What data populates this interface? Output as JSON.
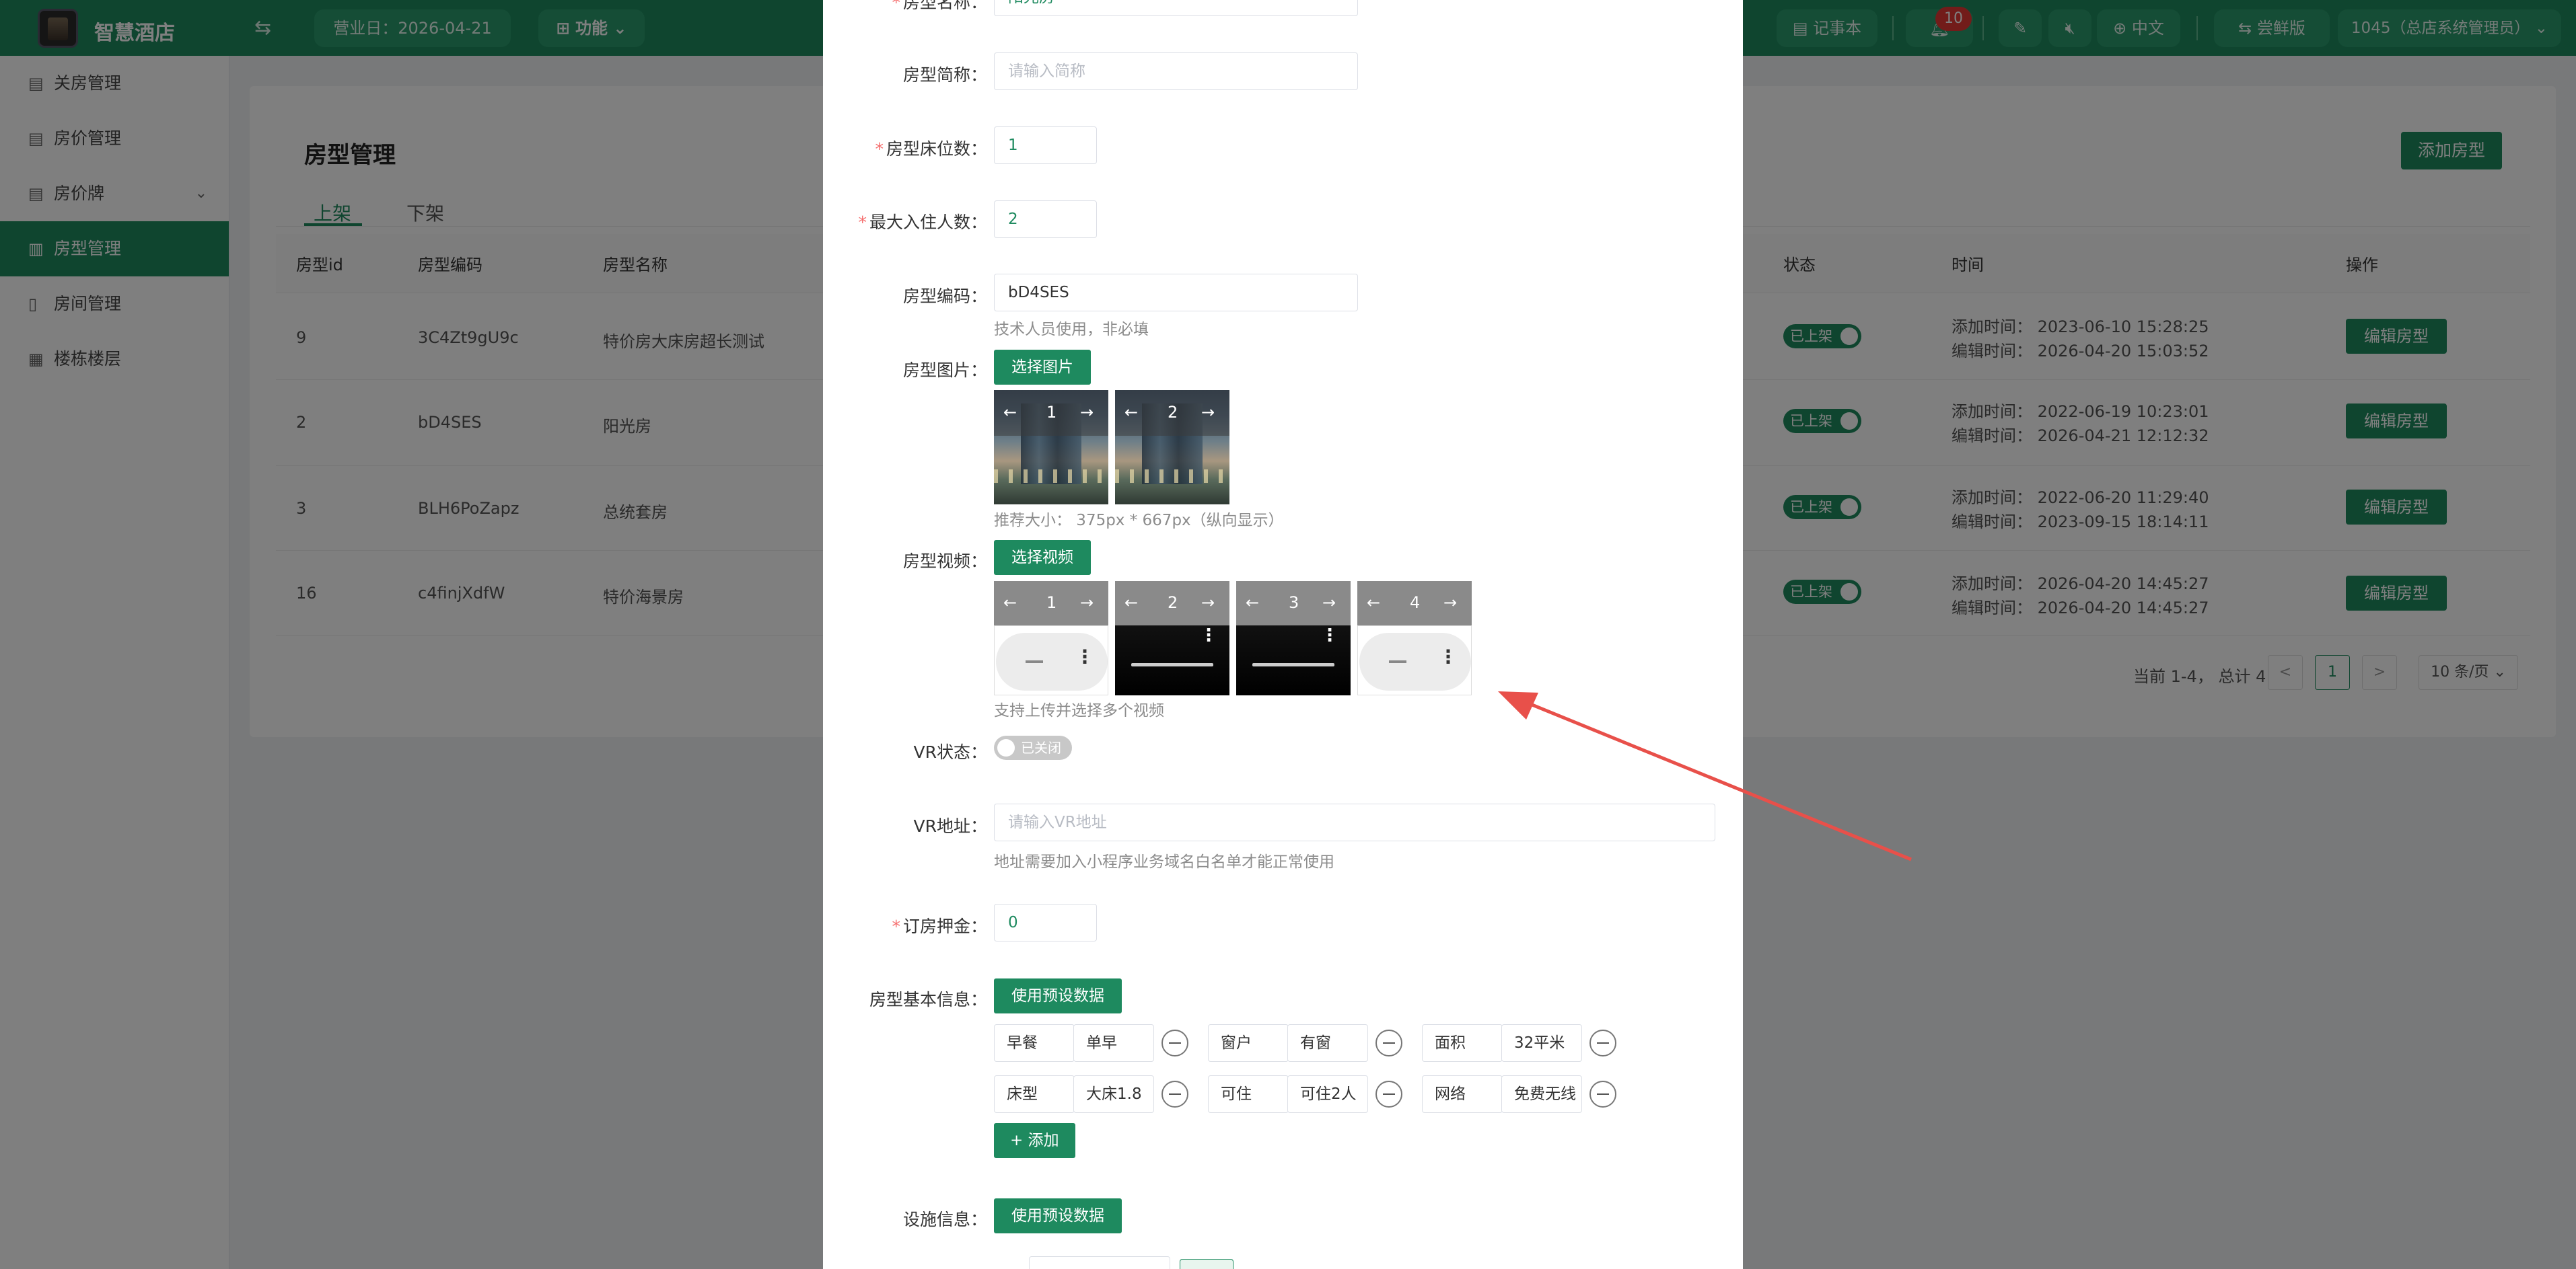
{
  "header": {
    "app_name": "智慧酒店",
    "business_date": "营业日：2026-04-21",
    "func_label": "功能",
    "notebook_label": "记事本",
    "notif_count": "10",
    "lang_label": "中文",
    "trial_label": "尝鲜版",
    "user_label": "1045（总店系统管理员）"
  },
  "sidebar": {
    "items": [
      {
        "label": "关房管理"
      },
      {
        "label": "房价管理"
      },
      {
        "label": "房价牌"
      },
      {
        "label": "房型管理"
      },
      {
        "label": "房间管理"
      },
      {
        "label": "楼栋楼层"
      }
    ]
  },
  "page": {
    "title": "房型管理",
    "add_button": "添加房型",
    "tabs": [
      "上架",
      "下架"
    ],
    "columns": {
      "id": "房型id",
      "code": "房型编码",
      "name": "房型名称",
      "status": "状态",
      "time": "时间",
      "action": "操作"
    },
    "rows": [
      {
        "id": "9",
        "code": "3C4Zt9gU9c",
        "name": "特价房大床房超长测试",
        "status": "已上架",
        "added": "添加时间：  2023-06-10 15:28:25",
        "edited": "编辑时间：  2026-04-20 15:03:52",
        "action": "编辑房型"
      },
      {
        "id": "2",
        "code": "bD4SES",
        "name": "阳光房",
        "status": "已上架",
        "added": "添加时间：  2022-06-19 10:23:01",
        "edited": "编辑时间：  2026-04-21 12:12:32",
        "action": "编辑房型"
      },
      {
        "id": "3",
        "code": "BLH6PoZapz",
        "name": "总统套房",
        "status": "已上架",
        "added": "添加时间：  2022-06-20 11:29:40",
        "edited": "编辑时间：  2023-09-15 18:14:11",
        "action": "编辑房型"
      },
      {
        "id": "16",
        "code": "c4finjXdfW",
        "name": "特价海景房",
        "status": "已上架",
        "added": "添加时间：  2026-04-20 14:45:27",
        "edited": "编辑时间：  2026-04-20 14:45:27",
        "action": "编辑房型"
      }
    ],
    "pager": {
      "summary": "当前 1-4， 总计 4",
      "prev": "<",
      "current": "1",
      "next": ">",
      "page_size": "10 条/页"
    }
  },
  "modal": {
    "name": {
      "label": "房型名称：",
      "value": "阳光房"
    },
    "short": {
      "label": "房型简称：",
      "placeholder": "请输入简称"
    },
    "beds": {
      "label": "房型床位数：",
      "value": "1"
    },
    "max_guests": {
      "label": "最大入住人数：",
      "value": "2"
    },
    "code": {
      "label": "房型编码：",
      "value": "bD4SES",
      "hint": "技术人员使用，非必填"
    },
    "images": {
      "label": "房型图片：",
      "button": "选择图片",
      "thumbs": [
        "1",
        "2"
      ],
      "hint": "推荐大小： 375px * 667px（纵向显示）"
    },
    "videos": {
      "label": "房型视频：",
      "button": "选择视频",
      "thumbs": [
        "1",
        "2",
        "3",
        "4"
      ],
      "hint": "支持上传并选择多个视频"
    },
    "vr_status": {
      "label": "VR状态：",
      "switch_text": "已关闭"
    },
    "vr_url": {
      "label": "VR地址：",
      "placeholder": "请输入VR地址",
      "hint": "地址需要加入小程序业务域名白名单才能正常使用"
    },
    "deposit": {
      "label": "订房押金：",
      "value": "0"
    },
    "basic_info": {
      "label": "房型基本信息：",
      "button": "使用预设数据",
      "pairs": [
        {
          "key": "早餐",
          "value": "单早"
        },
        {
          "key": "窗户",
          "value": "有窗"
        },
        {
          "key": "面积",
          "value": "32平米"
        },
        {
          "key": "床型",
          "value": "大床1.8"
        },
        {
          "key": "可住",
          "value": "可住2人"
        },
        {
          "key": "网络",
          "value": "免费无线"
        }
      ],
      "add_button": "+  添加"
    },
    "facility": {
      "label": "设施信息：",
      "button": "使用预设数据"
    }
  },
  "arrow_color": "#e8504a",
  "brand_color": "#1e8a5f"
}
